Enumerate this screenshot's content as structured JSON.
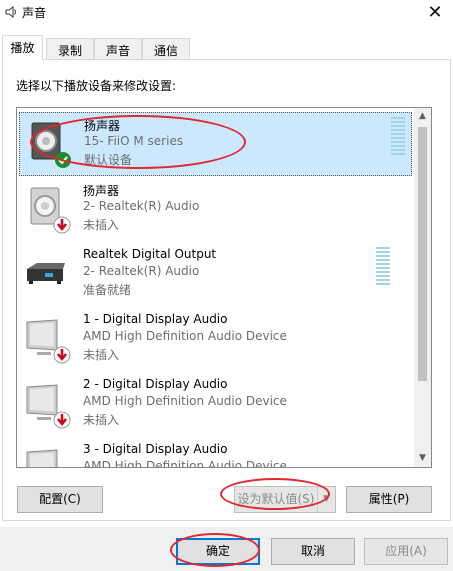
{
  "window": {
    "title": "声音",
    "close_glyph": "✕"
  },
  "tabs": [
    {
      "label": "播放",
      "active": true
    },
    {
      "label": "录制",
      "active": false
    },
    {
      "label": "声音",
      "active": false
    },
    {
      "label": "通信",
      "active": false
    }
  ],
  "instruction": "选择以下播放设备来修改设置:",
  "devices": [
    {
      "name": "扬声器",
      "subtitle": "15- FiiO M series",
      "status": "默认设备",
      "icon": "speaker-icon",
      "badge": "default-check-icon",
      "selected": true,
      "meter": true
    },
    {
      "name": "扬声器",
      "subtitle": "2- Realtek(R) Audio",
      "status": "未插入",
      "icon": "speaker-icon",
      "badge": "unplugged-arrow-icon",
      "selected": false,
      "meter": false
    },
    {
      "name": "Realtek Digital Output",
      "subtitle": "2- Realtek(R) Audio",
      "status": "准备就绪",
      "icon": "digital-output-icon",
      "badge": "",
      "selected": false,
      "meter": true
    },
    {
      "name": "1 - Digital Display Audio",
      "subtitle": "AMD High Definition Audio Device",
      "status": "未插入",
      "icon": "monitor-icon",
      "badge": "unplugged-arrow-icon",
      "selected": false,
      "meter": false
    },
    {
      "name": "2 - Digital Display Audio",
      "subtitle": "AMD High Definition Audio Device",
      "status": "未插入",
      "icon": "monitor-icon",
      "badge": "unplugged-arrow-icon",
      "selected": false,
      "meter": false
    },
    {
      "name": "3 - Digital Display Audio",
      "subtitle": "AMD High Definition Audio Device",
      "status": "",
      "icon": "monitor-icon",
      "badge": "",
      "selected": false,
      "meter": false
    }
  ],
  "buttons": {
    "configure": "配置(C)",
    "set_default": "设为默认值(S)",
    "properties": "属性(P)",
    "ok": "确定",
    "cancel": "取消",
    "apply": "应用(A)"
  },
  "colors": {
    "selection": "#cce8ff",
    "annotation": "#e0282e",
    "meter": "#9fd4ea",
    "focus": "#0078d7"
  }
}
